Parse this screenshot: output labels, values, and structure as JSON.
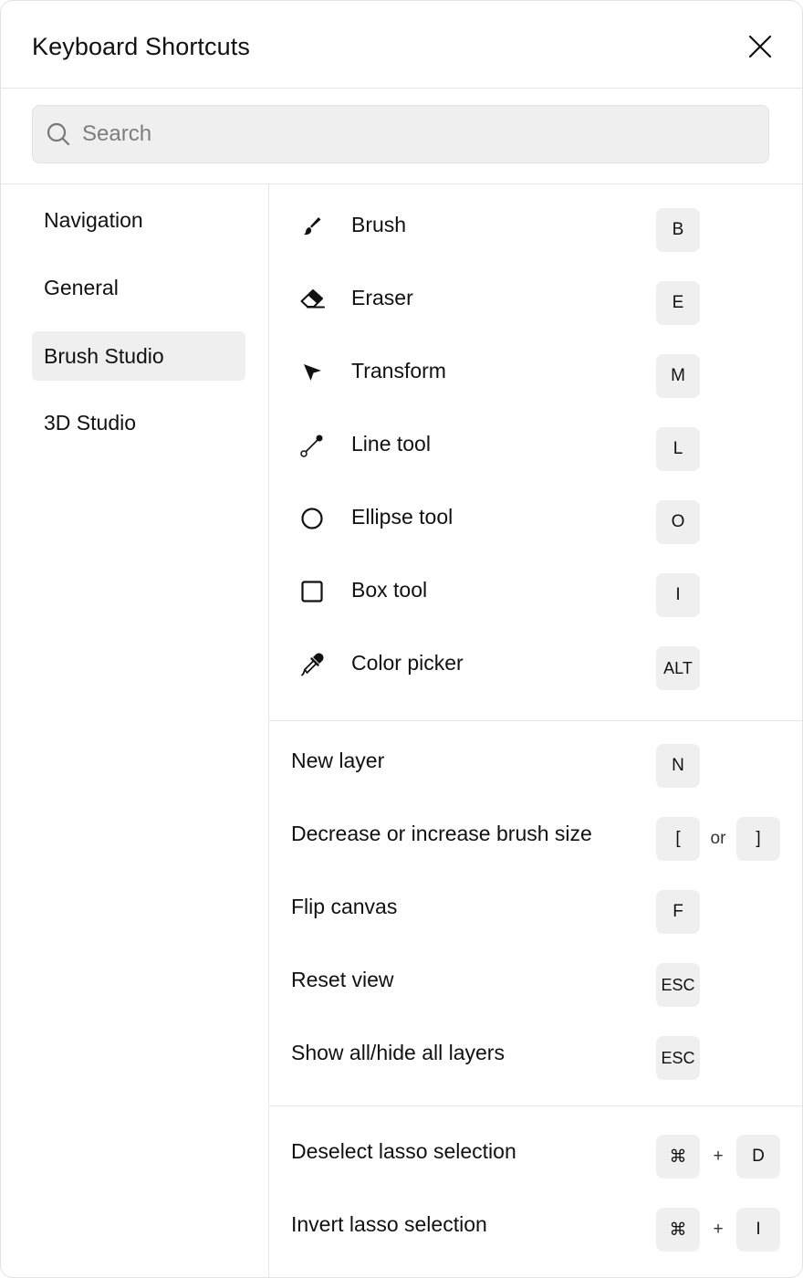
{
  "dialog": {
    "title": "Keyboard Shortcuts"
  },
  "search": {
    "placeholder": "Search",
    "value": ""
  },
  "sidebar": {
    "items": [
      {
        "label": "Navigation",
        "active": false
      },
      {
        "label": "General",
        "active": false
      },
      {
        "label": "Brush Studio",
        "active": true
      },
      {
        "label": "3D Studio",
        "active": false
      }
    ]
  },
  "tools": [
    {
      "icon": "brush-icon",
      "label": "Brush",
      "key": "B"
    },
    {
      "icon": "eraser-icon",
      "label": "Eraser",
      "key": "E"
    },
    {
      "icon": "transform-arrow-icon",
      "label": "Transform",
      "key": "M"
    },
    {
      "icon": "line-tool-icon",
      "label": "Line tool",
      "key": "L"
    },
    {
      "icon": "ellipse-icon",
      "label": "Ellipse tool",
      "key": "O"
    },
    {
      "icon": "box-icon",
      "label": "Box tool",
      "key": "I"
    },
    {
      "icon": "eyedropper-icon",
      "label": "Color picker",
      "key": "ALT"
    }
  ],
  "actions": [
    {
      "label": "New layer",
      "keys": [
        "N"
      ]
    },
    {
      "label": "Decrease or increase brush size",
      "keys": [
        "[",
        "]"
      ],
      "separator": "or"
    },
    {
      "label": "Flip canvas",
      "keys": [
        "F"
      ]
    },
    {
      "label": "Reset view",
      "keys": [
        "ESC"
      ]
    },
    {
      "label": "Show all/hide all layers",
      "keys": [
        "ESC"
      ]
    }
  ],
  "selection": [
    {
      "label": "Deselect lasso selection",
      "keys": [
        "⌘",
        "D"
      ],
      "separator": "+"
    },
    {
      "label": "Invert lasso selection",
      "keys": [
        "⌘",
        "I"
      ],
      "separator": "+"
    }
  ]
}
